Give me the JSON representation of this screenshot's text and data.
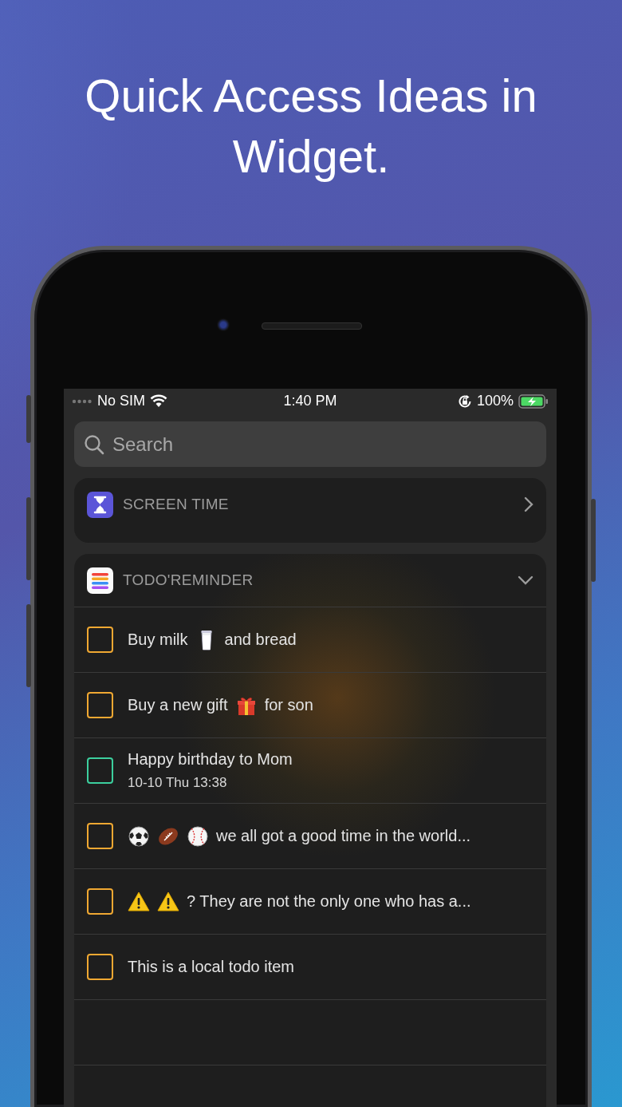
{
  "headline": "Quick Access Ideas in Widget.",
  "status_bar": {
    "carrier": "No SIM",
    "time": "1:40 PM",
    "battery": "100%"
  },
  "search": {
    "placeholder": "Search"
  },
  "widgets": [
    {
      "kind": "screen-time",
      "title": "SCREEN TIME",
      "expanded": false
    },
    {
      "kind": "todo",
      "title": "TODO'REMINDER",
      "expanded": true,
      "items": [
        {
          "checked": false,
          "color": "#f0a832",
          "parts": [
            {
              "kind": "text",
              "text": "Buy milk"
            },
            {
              "kind": "milk"
            },
            {
              "kind": "text",
              "text": "and bread"
            }
          ]
        },
        {
          "checked": false,
          "color": "#f0a832",
          "parts": [
            {
              "kind": "text",
              "text": "Buy a new gift"
            },
            {
              "kind": "gift"
            },
            {
              "kind": "text",
              "text": "for son"
            }
          ]
        },
        {
          "checked": false,
          "color": "#3ccf9e",
          "parts": [
            {
              "kind": "text",
              "text": "Happy birthday to Mom"
            }
          ],
          "detail": "10-10 Thu 13:38"
        },
        {
          "checked": false,
          "color": "#f0a832",
          "parts": [
            {
              "kind": "soccer"
            },
            {
              "kind": "football"
            },
            {
              "kind": "baseball"
            },
            {
              "kind": "text",
              "text": "we all got a good time in the world..."
            }
          ]
        },
        {
          "checked": false,
          "color": "#f0a832",
          "parts": [
            {
              "kind": "warning"
            },
            {
              "kind": "warning"
            },
            {
              "kind": "text",
              "text": "? They are not the only one who has a..."
            }
          ]
        },
        {
          "checked": false,
          "color": "#f0a832",
          "parts": [
            {
              "kind": "text",
              "text": "This is a local todo item"
            }
          ]
        }
      ]
    }
  ]
}
